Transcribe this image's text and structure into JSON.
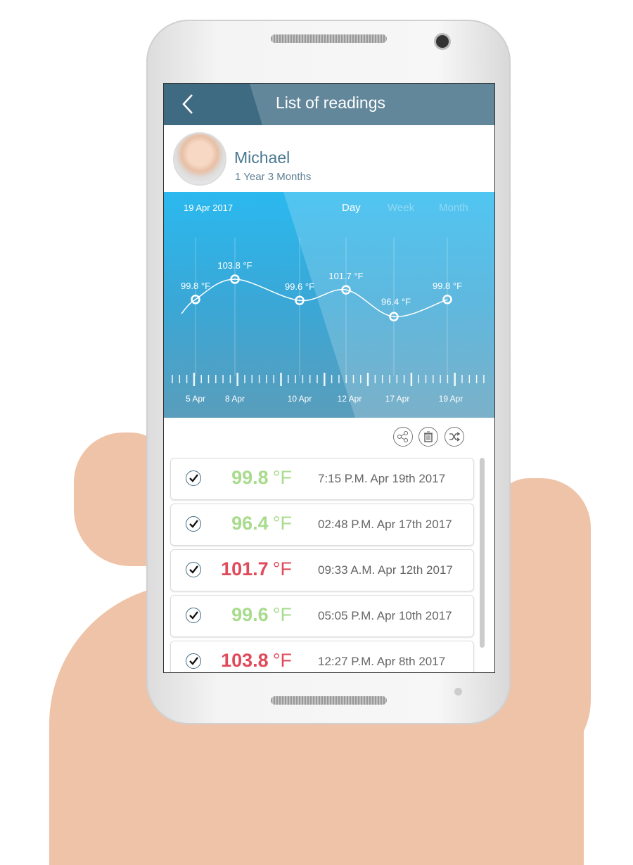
{
  "header": {
    "title": "List of readings",
    "back_icon": "chevron-left-icon"
  },
  "profile": {
    "name": "Michael",
    "age": "1 Year 3 Months"
  },
  "chart_data": {
    "type": "line",
    "date": "19 Apr 2017",
    "periods": [
      {
        "label": "Day",
        "active": true
      },
      {
        "label": "Week",
        "active": false
      },
      {
        "label": "Month",
        "active": false
      }
    ],
    "categories": [
      "5 Apr",
      "8 Apr",
      "10 Apr",
      "12 Apr",
      "17 Apr",
      "19 Apr"
    ],
    "values": [
      99.8,
      103.8,
      99.6,
      101.7,
      96.4,
      99.8
    ],
    "labels": [
      "99.8 °F",
      "103.8 °F",
      "99.6 °F",
      "101.7 °F",
      "96.4 °F",
      "99.8 °F"
    ],
    "unit": "°F"
  },
  "actions": [
    {
      "icon": "share-icon"
    },
    {
      "icon": "trash-icon"
    },
    {
      "icon": "shuffle-icon"
    }
  ],
  "colors": {
    "normal": "#a8dc8c",
    "fever": "#e04a5a",
    "header": "#63879a",
    "chart": "#2bb9ef"
  },
  "readings": [
    {
      "value": "99.8",
      "unit": "°F",
      "time": "7:15 P.M. Apr 19th 2017",
      "status": "normal"
    },
    {
      "value": "96.4",
      "unit": "°F",
      "time": "02:48 P.M. Apr 17th 2017",
      "status": "normal"
    },
    {
      "value": "101.7",
      "unit": "°F",
      "time": "09:33 A.M. Apr 12th 2017",
      "status": "fever"
    },
    {
      "value": "99.6",
      "unit": "°F",
      "time": "05:05 P.M. Apr 10th 2017",
      "status": "normal"
    },
    {
      "value": "103.8",
      "unit": "°F",
      "time": "12:27 P.M. Apr 8th 2017",
      "status": "fever"
    }
  ]
}
